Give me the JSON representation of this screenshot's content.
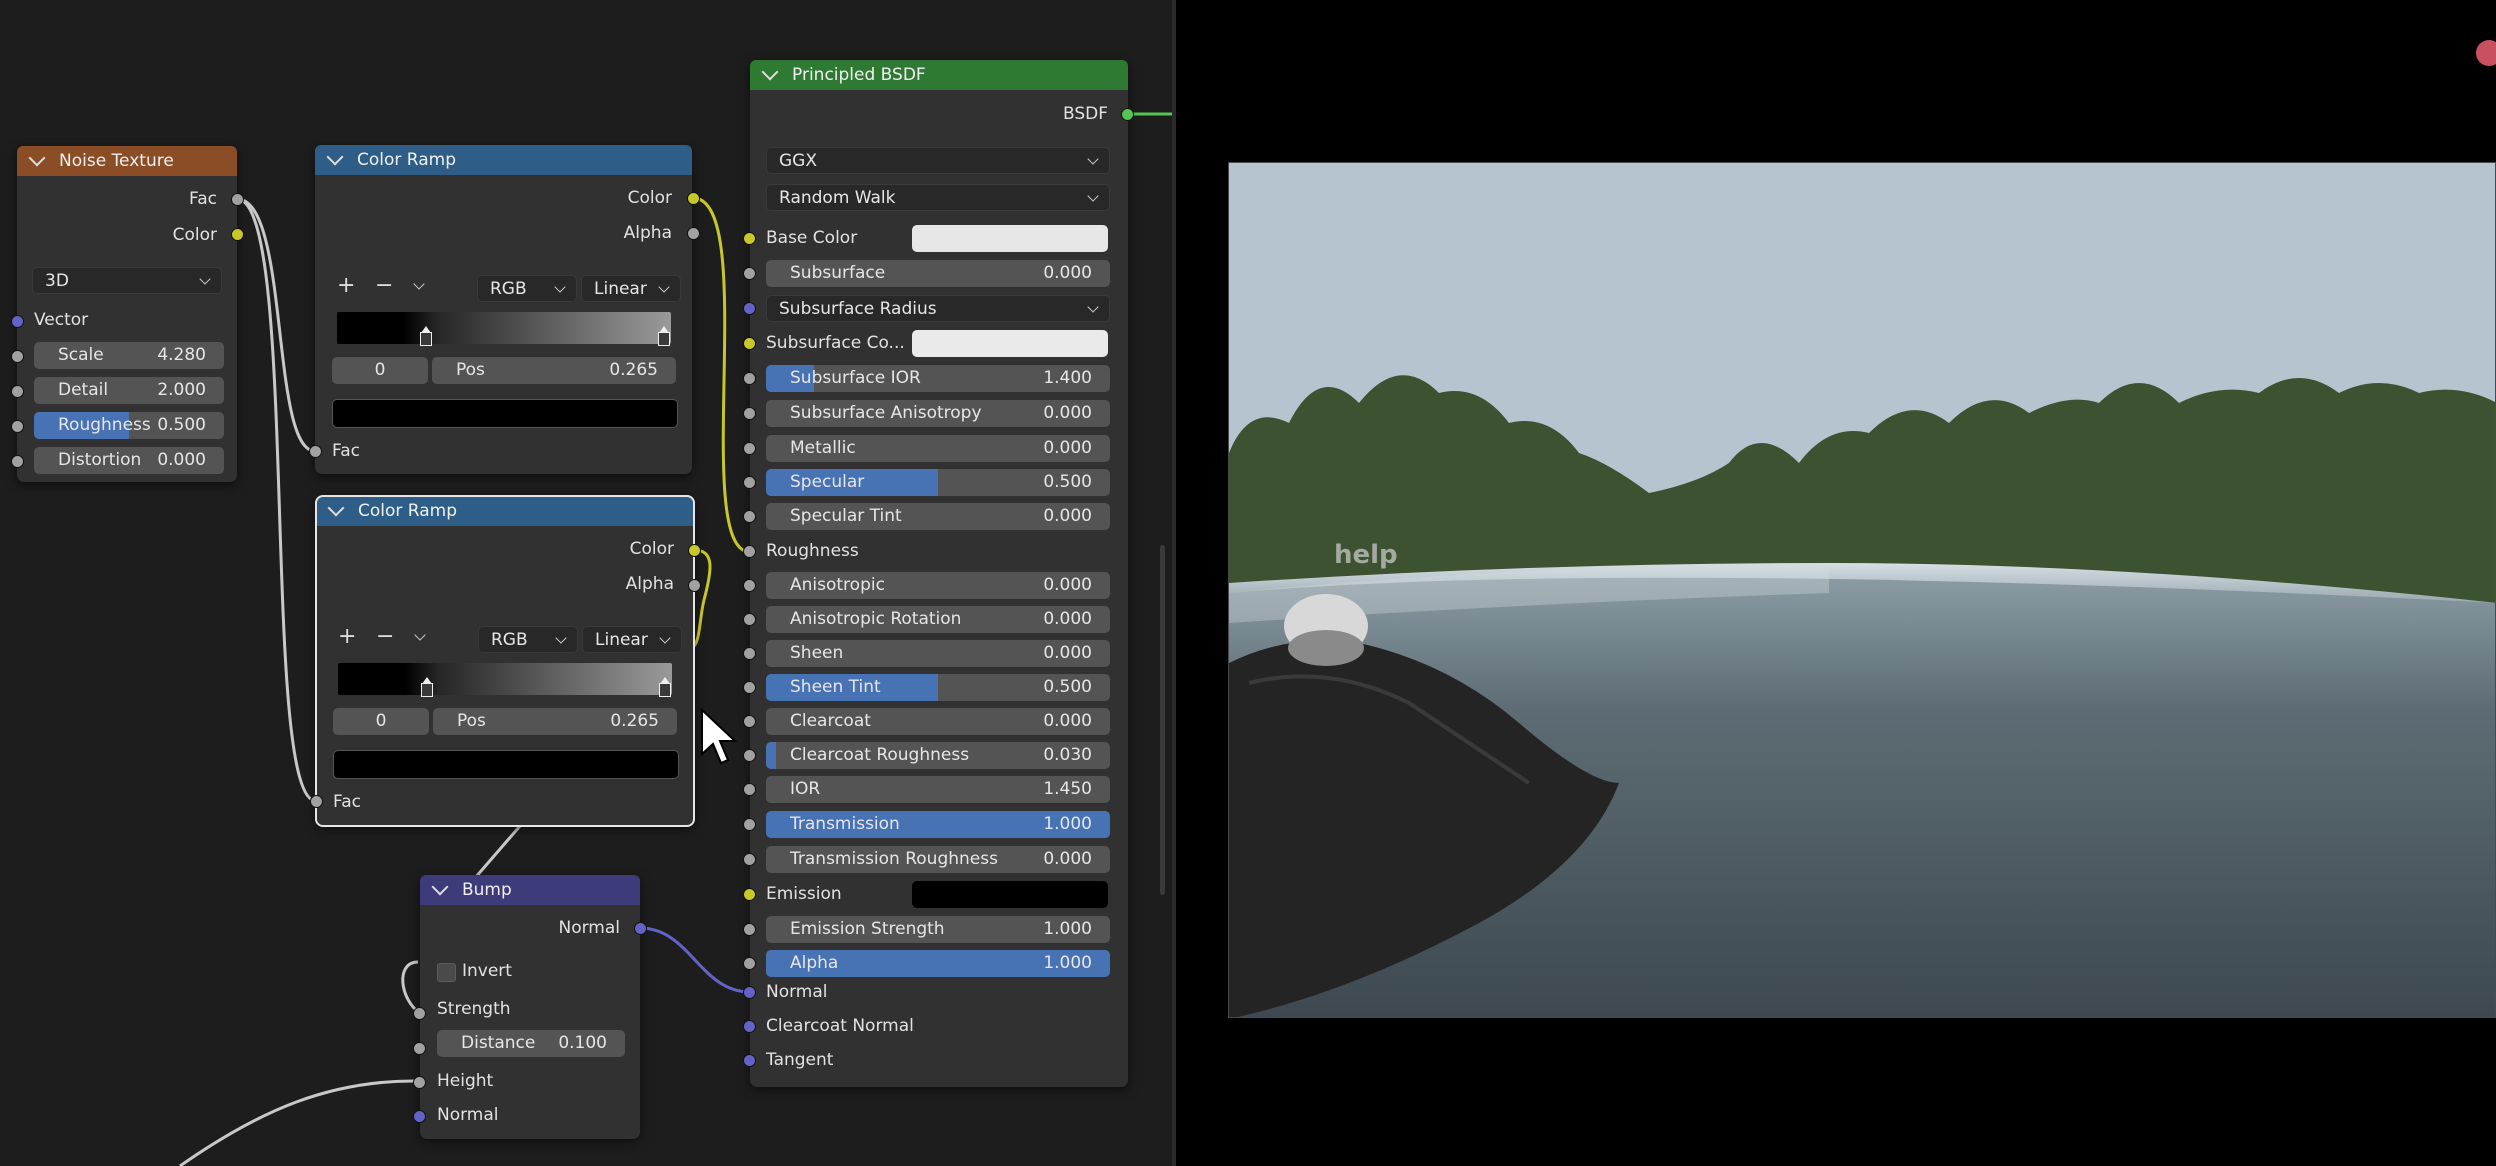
{
  "noise_texture": {
    "title": "Noise Texture",
    "out_fac": "Fac",
    "out_color": "Color",
    "dimension": "3D",
    "in_vector": "Vector",
    "scale": {
      "label": "Scale",
      "value": "4.280"
    },
    "detail": {
      "label": "Detail",
      "value": "2.000"
    },
    "roughness": {
      "label": "Roughness",
      "value": "0.500",
      "fraction": 0.5
    },
    "distortion": {
      "label": "Distortion",
      "value": "0.000"
    }
  },
  "color_ramp_1": {
    "title": "Color Ramp",
    "out_color": "Color",
    "out_alpha": "Alpha",
    "add": "+",
    "remove": "−",
    "mode": "RGB",
    "interpolation": "Linear",
    "index": "0",
    "pos_label": "Pos",
    "pos_value": "0.265",
    "in_fac": "Fac"
  },
  "color_ramp_2": {
    "title": "Color Ramp",
    "out_color": "Color",
    "out_alpha": "Alpha",
    "add": "+",
    "remove": "−",
    "mode": "RGB",
    "interpolation": "Linear",
    "index": "0",
    "pos_label": "Pos",
    "pos_value": "0.265",
    "in_fac": "Fac"
  },
  "bump": {
    "title": "Bump",
    "out_normal": "Normal",
    "invert": "Invert",
    "strength": "Strength",
    "distance": {
      "label": "Distance",
      "value": "0.100"
    },
    "height": "Height",
    "normal": "Normal"
  },
  "bsdf": {
    "title": "Principled BSDF",
    "out": "BSDF",
    "distribution": "GGX",
    "subsurface_method": "Random Walk",
    "base_color": "Base Color",
    "subsurface": {
      "label": "Subsurface",
      "value": "0.000"
    },
    "subsurface_radius": "Subsurface Radius",
    "subsurface_color": "Subsurface Co...",
    "subsurface_ior": {
      "label": "Subsurface IOR",
      "value": "1.400",
      "fraction": 0.14
    },
    "subsurface_anisotropy": {
      "label": "Subsurface Anisotropy",
      "value": "0.000"
    },
    "metallic": {
      "label": "Metallic",
      "value": "0.000"
    },
    "specular": {
      "label": "Specular",
      "value": "0.500",
      "fraction": 0.5
    },
    "specular_tint": {
      "label": "Specular Tint",
      "value": "0.000"
    },
    "roughness": "Roughness",
    "anisotropic": {
      "label": "Anisotropic",
      "value": "0.000"
    },
    "anisotropic_rotation": {
      "label": "Anisotropic Rotation",
      "value": "0.000"
    },
    "sheen": {
      "label": "Sheen",
      "value": "0.000"
    },
    "sheen_tint": {
      "label": "Sheen Tint",
      "value": "0.500",
      "fraction": 0.5
    },
    "clearcoat": {
      "label": "Clearcoat",
      "value": "0.000"
    },
    "clearcoat_roughness": {
      "label": "Clearcoat Roughness",
      "value": "0.030",
      "fraction": 0.03
    },
    "ior": {
      "label": "IOR",
      "value": "1.450"
    },
    "transmission": {
      "label": "Transmission",
      "value": "1.000",
      "fraction": 1.0
    },
    "transmission_roughness": {
      "label": "Transmission Roughness",
      "value": "0.000"
    },
    "emission": "Emission",
    "emission_strength": {
      "label": "Emission Strength",
      "value": "1.000"
    },
    "alpha": {
      "label": "Alpha",
      "value": "1.000",
      "fraction": 1.0
    },
    "normal": "Normal",
    "clearcoat_normal": "Clearcoat Normal",
    "tangent": "Tangent"
  },
  "viewport": {
    "overlay_text": "help"
  },
  "colors": {
    "header_noise": "#8a4d26",
    "header_ramp": "#2e5e87",
    "header_bsdf": "#2f7a32",
    "header_bump": "#3e3b7a",
    "slider_fill": "#4772b3",
    "node_body": "#313131"
  }
}
